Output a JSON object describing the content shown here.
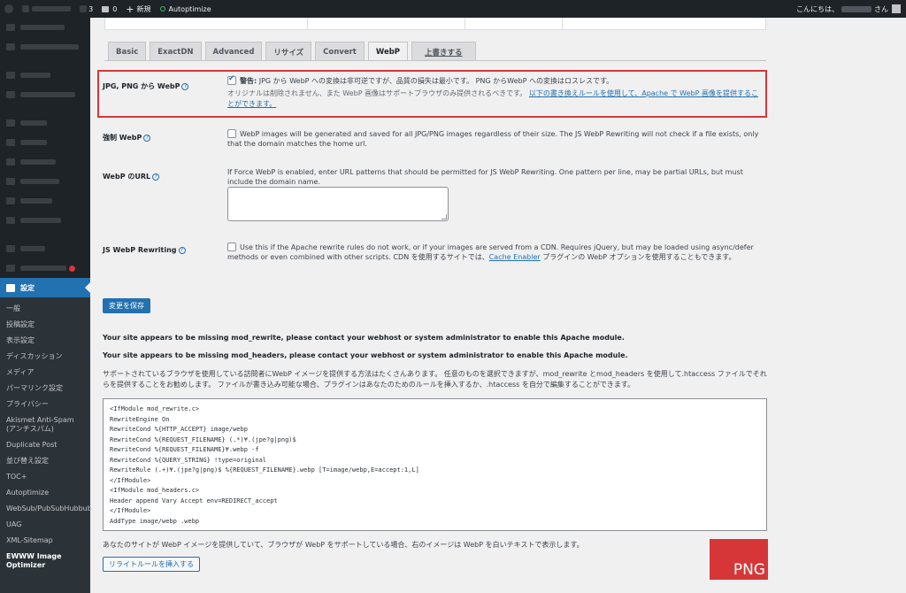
{
  "adminbar": {
    "comments_count": "3",
    "pending_count": "0",
    "new_label": "新規",
    "plugin_label": "Autoptimize",
    "greeting": "こんにちは、",
    "greeting_suffix": "さん"
  },
  "sidebar": {
    "active_label": "設定",
    "submenu": [
      "一般",
      "投稿設定",
      "表示設定",
      "ディスカッション",
      "メディア",
      "パーマリンク設定",
      "プライバシー",
      "Akismet Anti-Spam (アンチスパム)",
      "Duplicate Post",
      "並び替え設定",
      "TOC+",
      "Autoptimize",
      "WebSub/PubSubHubbub",
      "UAG",
      "XML-Sitemap",
      "EWWW Image Optimizer"
    ]
  },
  "tabs": [
    "Basic",
    "ExactDN",
    "Advanced",
    "リサイズ",
    "Convert",
    "WebP",
    "上書きする"
  ],
  "rows": {
    "jpg_png": {
      "label": "JPG, PNG から WebP",
      "warning_bold": "警告:",
      "line1": " JPG から WebP への変換は非可逆ですが、品質の損失は最小です。 PNG からWebP への変換はロスレスです。",
      "line2": "オリジナルは削除されません、また WebP 画像はサポートブラウザのみ提供されるべきです。",
      "link": "以下の書き換えルールを使用して、Apache で WebP 画像を提供することができます。"
    },
    "force_webp": {
      "label": "強制 WebP",
      "desc": "WebP images will be generated and saved for all JPG/PNG images regardless of their size. The JS WebP Rewriting will not check if a file exists, only that the domain matches the home url."
    },
    "webp_url": {
      "label": "WebP のURL",
      "desc": "If Force WebP is enabled, enter URL patterns that should be permitted for JS WebP Rewriting. One pattern per line, may be partial URLs, but must include the domain name."
    },
    "js_webp": {
      "label": "JS WebP Rewriting",
      "desc1": "Use this if the Apache rewrite rules do not work, or if your images are served from a CDN. Requires jQuery, but may be loaded using async/defer methods or even combined with other scripts. CDN を使用するサイトでは、",
      "link": "Cache Enabler",
      "desc2": " プラグインの WebP オプションを使用することもできます。"
    }
  },
  "save_button": "変更を保存",
  "notes": {
    "rewrite": "Your site appears to be missing mod_rewrite, please contact your webhost or system administrator to enable this Apache module.",
    "headers": "Your site appears to be missing mod_headers, please contact your webhost or system administrator to enable this Apache module.",
    "methods": "サポートされているブラウザを使用している訪問者にWebP イメージを提供する方法はたくさんあります。 任意のものを選択できますが、mod_rewrite とmod_headers を使用して.htaccess ファイルでそれらを提供することをお勧めします。 ファイルが書き込み可能な場合、プラグインはあなたのためのルールを挿入するか、.htaccess を自分で編集することができます。"
  },
  "code_lines": [
    "<IfModule mod_rewrite.c>",
    "RewriteEngine On",
    "RewriteCond %{HTTP_ACCEPT} image/webp",
    "RewriteCond %{REQUEST_FILENAME} (.*)¥.(jpe?g|png)$",
    "RewriteCond %{REQUEST_FILENAME}¥.webp -f",
    "RewriteCond %{QUERY_STRING} !type=original",
    "RewriteRule (.+)¥.(jpe?g|png)$ %{REQUEST_FILENAME}.webp [T=image/webp,E=accept:1,L]",
    "</IfModule>",
    "<IfModule mod_headers.c>",
    "Header append Vary Accept env=REDIRECT_accept",
    "</IfModule>",
    "AddType image/webp .webp"
  ],
  "bottom_note": "あなたのサイトが WebP イメージを提供していて、ブラウザが WebP をサポートしている場合、右のイメージは WebP を白いテキストで表示します。",
  "png_label": "PNG",
  "insert_button": "リライトルールを挿入する",
  "colors": {
    "accent": "#2271b1",
    "admin_dark": "#1d2327",
    "highlight_red": "#d63638"
  }
}
